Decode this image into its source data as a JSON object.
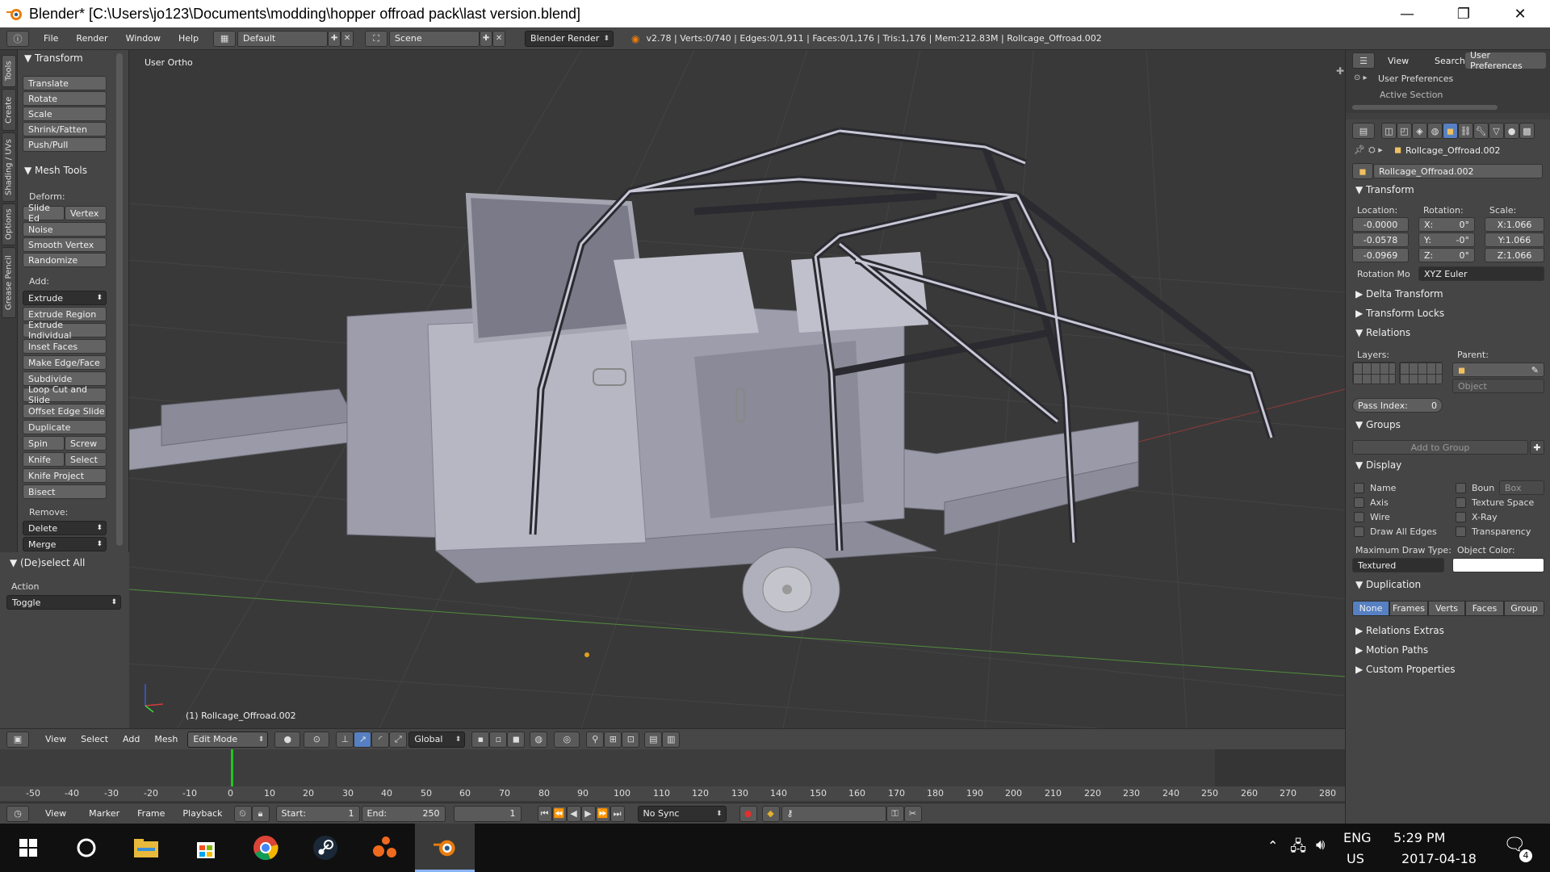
{
  "window": {
    "title": "Blender* [C:\\Users\\jo123\\Documents\\modding\\hopper offroad pack\\last version.blend]",
    "minimize_glyph": "—",
    "maximize_glyph": "❐",
    "close_glyph": "✕"
  },
  "infobar": {
    "menus": [
      "File",
      "Render",
      "Window",
      "Help"
    ],
    "layout": "Default",
    "scene": "Scene",
    "engine": "Blender Render",
    "stats": "v2.78 | Verts:0/740 | Edges:0/1,911 | Faces:0/1,176 | Tris:1,176 | Mem:212.83M | Rollcage_Offroad.002"
  },
  "tool_tabs": [
    "Tools",
    "Create",
    "Shading / UVs",
    "Options",
    "Grease Pencil"
  ],
  "toolshelf": {
    "transform_header": "Transform",
    "transform_buttons": [
      "Translate",
      "Rotate",
      "Scale",
      "Shrink/Fatten",
      "Push/Pull"
    ],
    "mesh_tools_header": "Mesh Tools",
    "deform_label": "Deform:",
    "slide_edge": "Slide Ed",
    "vertex": "Vertex",
    "deform_buttons": [
      "Noise",
      "Smooth Vertex",
      "Randomize"
    ],
    "add_label": "Add:",
    "extrude": "Extrude",
    "add_buttons": [
      "Extrude Region",
      "Extrude Individual",
      "Inset Faces",
      "Make Edge/Face",
      "Subdivide",
      "Loop Cut and Slide",
      "Offset Edge Slide",
      "Duplicate"
    ],
    "spin": "Spin",
    "screw": "Screw",
    "knife": "Knife",
    "select": "Select",
    "knife_project": "Knife Project",
    "bisect": "Bisect",
    "remove_label": "Remove:",
    "delete": "Delete",
    "merge": "Merge",
    "deselect_header": "(De)select All",
    "action_label": "Action",
    "action_value": "Toggle"
  },
  "viewport": {
    "view_label": "User Ortho",
    "object_label": "(1) Rollcage_Offroad.002"
  },
  "vp_header": {
    "menus": [
      "View",
      "Select",
      "Add",
      "Mesh"
    ],
    "mode": "Edit Mode",
    "orientation": "Global"
  },
  "timeline": {
    "ticks": [
      "-50",
      "-40",
      "-30",
      "-20",
      "-10",
      "0",
      "10",
      "20",
      "30",
      "40",
      "50",
      "60",
      "70",
      "80",
      "90",
      "100",
      "110",
      "120",
      "130",
      "140",
      "150",
      "160",
      "170",
      "180",
      "190",
      "200",
      "210",
      "220",
      "230",
      "240",
      "250",
      "260",
      "270",
      "280"
    ],
    "menus": [
      "View",
      "Marker",
      "Frame",
      "Playback"
    ],
    "start_label": "Start:",
    "start_value": "1",
    "end_label": "End:",
    "end_value": "250",
    "current": "1",
    "sync": "No Sync"
  },
  "outliner": {
    "tabs": [
      "View",
      "Search",
      "User Preferences"
    ],
    "item": "User Preferences",
    "sub": "Active Section"
  },
  "properties": {
    "object_name": "Rollcage_Offroad.002",
    "field_name": "Rollcage_Offroad.002",
    "transform_header": "Transform",
    "location_label": "Location:",
    "rotation_label": "Rotation:",
    "scale_label": "Scale:",
    "location": [
      "-0.0000",
      "-0.0578",
      "-0.0969"
    ],
    "rotation": [
      [
        "X:",
        "0°"
      ],
      [
        "Y:",
        "-0°"
      ],
      [
        "Z:",
        "0°"
      ]
    ],
    "scale": [
      "X:1.066",
      "Y:1.066",
      "Z:1.066"
    ],
    "rotation_mode_label": "Rotation Mo",
    "rotation_mode": "XYZ Euler",
    "delta_transform": "Delta Transform",
    "transform_locks": "Transform Locks",
    "relations": "Relations",
    "layers_label": "Layers:",
    "parent_label": "Parent:",
    "object_placeholder": "Object",
    "pass_index_label": "Pass Index:",
    "pass_index": "0",
    "groups": "Groups",
    "add_to_group": "Add to Group",
    "display": "Display",
    "display_checks_left": [
      "Name",
      "Axis",
      "Wire",
      "Draw All Edges"
    ],
    "display_checks_right": [
      "Boun",
      "Texture Space",
      "X-Ray",
      "Transparency"
    ],
    "bounds_type": "Box",
    "max_draw_label": "Maximum Draw Type:",
    "object_color_label": "Object Color:",
    "max_draw_value": "Textured",
    "duplication": "Duplication",
    "dup_tabs": [
      "None",
      "Frames",
      "Verts",
      "Faces",
      "Group"
    ],
    "relations_extras": "Relations Extras",
    "motion_paths": "Motion Paths",
    "custom_properties": "Custom Properties"
  },
  "taskbar": {
    "lang": "ENG",
    "region": "US",
    "time": "5:29 PM",
    "date": "2017-04-18",
    "notifications": "4"
  },
  "colors": {
    "accent_blue": "#5680c2",
    "timeline_cursor": "#22c322",
    "blender_orange": "#e87d0d"
  }
}
